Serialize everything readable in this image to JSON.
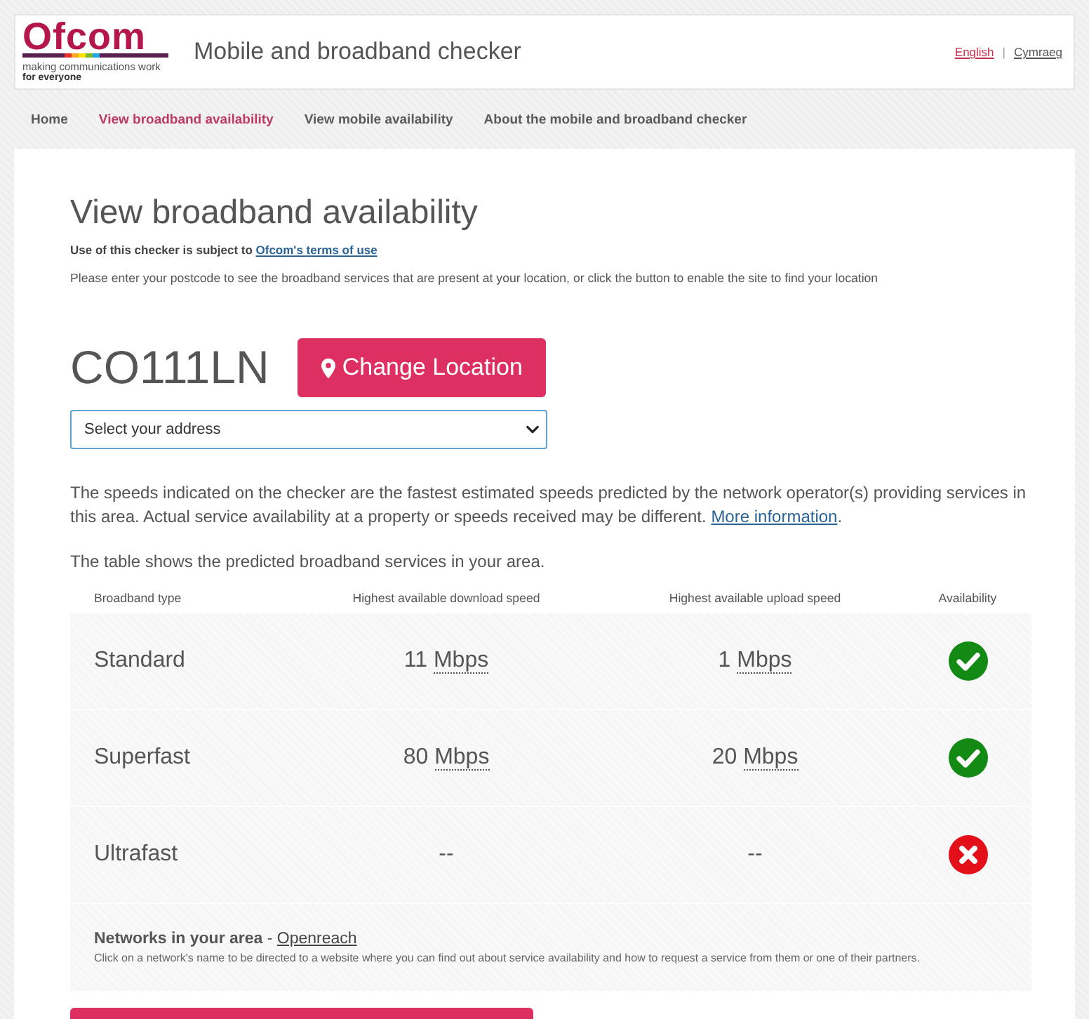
{
  "header": {
    "logo": {
      "name": "Ofcom",
      "tagline": "making communications work",
      "tagline_2": "for everyone"
    },
    "title": "Mobile and broadband checker",
    "languages": {
      "items": [
        {
          "label": "English",
          "selected": true
        },
        {
          "label": "Cymraeg",
          "selected": false
        }
      ],
      "separator": "|"
    }
  },
  "nav": [
    {
      "label": "Home",
      "selected": false
    },
    {
      "label": "View broadband availability",
      "selected": true
    },
    {
      "label": "View mobile availability",
      "selected": false
    },
    {
      "label": "About the mobile and broadband checker",
      "selected": false
    }
  ],
  "page": {
    "title": "View broadband availability",
    "terms": {
      "text": "Use of this checker is subject to",
      "link": "Ofcom's terms of use"
    },
    "instructions": "Please enter your postcode to see the broadband services that are present at your location, or click the button to enable the site to find your location",
    "postcode": "CO111LN",
    "change_button": "Change Location",
    "address_select": {
      "value": "Select your address"
    },
    "disclaimer": {
      "text": "The speeds indicated on the checker are the fastest estimated speeds predicted by the network operator(s) providing services in this area. Actual service availability at a property or speeds received may be different.",
      "link": "More information",
      "after": "."
    },
    "table_intro": "The table shows the predicted broadband services in your area."
  },
  "table": {
    "columns": [
      "Broadband type",
      "Highest available download speed",
      "Highest available upload speed",
      "Availability"
    ],
    "rows": [
      {
        "type": "Standard",
        "download": {
          "value": "11",
          "unit": "Mbps"
        },
        "upload": {
          "value": "1",
          "unit": "Mbps"
        },
        "available": true
      },
      {
        "type": "Superfast",
        "download": {
          "value": "80",
          "unit": "Mbps"
        },
        "upload": {
          "value": "20",
          "unit": "Mbps"
        },
        "available": true
      },
      {
        "type": "Ultrafast",
        "download": {
          "value": "--"
        },
        "upload": {
          "value": "--"
        },
        "available": false
      }
    ]
  },
  "networks": {
    "heading": "**Networks in your area** -",
    "link": "Openreach",
    "note": "Click on a network's name to be directed to a website where you can find out about service availability and how to request a service from them or one of their partners."
  }
}
